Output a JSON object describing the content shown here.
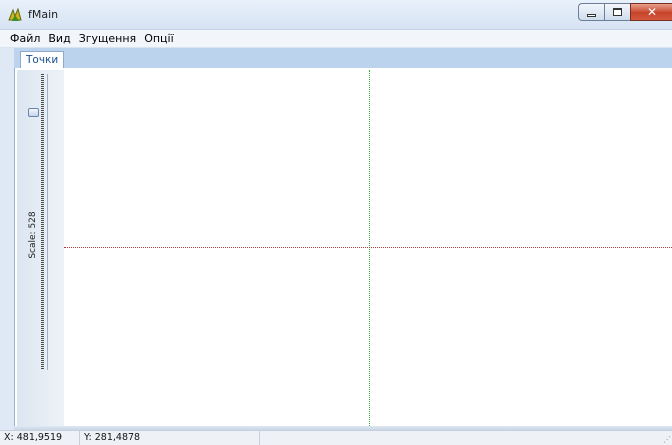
{
  "window": {
    "title": "fMain",
    "controls": {
      "minimize": "minimize",
      "maximize": "maximize",
      "close": "✕"
    }
  },
  "menu": {
    "items": [
      "Файл",
      "Вид",
      "Згущення",
      "Опції"
    ]
  },
  "tabs": [
    {
      "label": "Точки",
      "active": true
    }
  ],
  "scale": {
    "label": "Scale: 528"
  },
  "statusbar": {
    "x": "X: 481,9519",
    "y": "Y: 281,4878"
  },
  "colors": {
    "x_axis": "#b23a3a",
    "y_axis": "#3caf3c",
    "tab_strip": "#bcd3ee"
  },
  "icons": {
    "app": "app-icon",
    "slider_thumb": "slider-thumb"
  }
}
